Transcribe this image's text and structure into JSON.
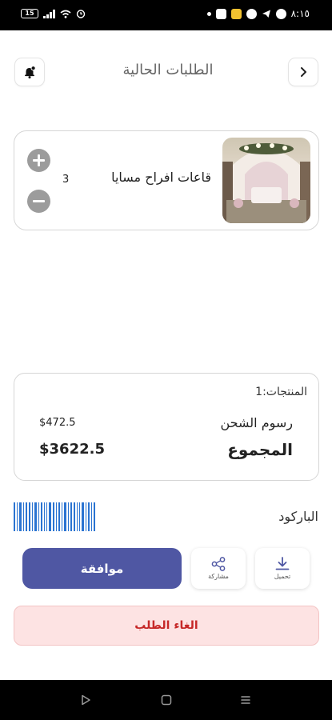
{
  "status_bar": {
    "battery": "15",
    "time": "٨:١٥"
  },
  "header": {
    "title": "الطلبات الحالية"
  },
  "product": {
    "name": "قاعات افراح مسايا",
    "quantity": "3"
  },
  "summary": {
    "products_count": "المنتجات:1",
    "shipping_label": "رسوم الشحن",
    "shipping_value": "$472.5",
    "total_label": "المجموع",
    "total_value": "$3622.5"
  },
  "barcode": {
    "label": "الباركود"
  },
  "actions": {
    "approve_label": "موافقة",
    "share_label": "مشاركة",
    "download_label": "تحميل",
    "cancel_label": "الغاء الطلب"
  },
  "colors": {
    "primary": "#4f57a3",
    "cancel_bg": "#fde3e3",
    "cancel_text": "#c62828",
    "barcode": "#2b74d1"
  },
  "icons": {
    "back": "chevron-right-icon",
    "bell": "bell-icon",
    "share": "share-icon",
    "download": "download-icon"
  }
}
